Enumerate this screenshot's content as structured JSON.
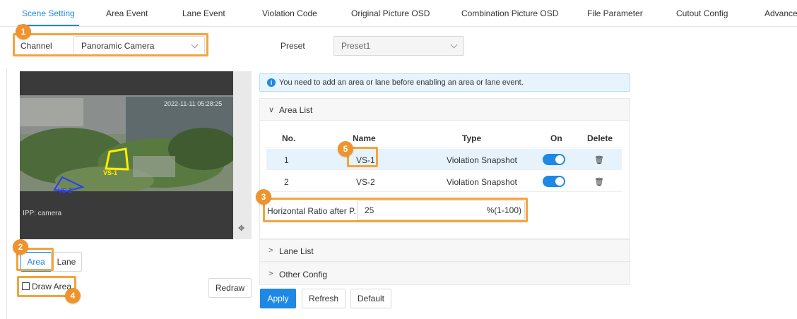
{
  "tabs": [
    {
      "label": "Scene Setting",
      "active": true
    },
    {
      "label": "Area Event"
    },
    {
      "label": "Lane Event"
    },
    {
      "label": "Violation Code"
    },
    {
      "label": "Original Picture OSD"
    },
    {
      "label": "Combination Picture OSD"
    },
    {
      "label": "File Parameter"
    },
    {
      "label": "Cutout Config"
    },
    {
      "label": "Advanced"
    }
  ],
  "channel": {
    "label": "Channel",
    "value": "Panoramic Camera"
  },
  "preset": {
    "label": "Preset",
    "value": "Preset1"
  },
  "video": {
    "timestamp": "2022-11-11 05:28:25",
    "overlay_label": "IPP: camera",
    "area_labels": [
      "VS-1",
      "VS-2"
    ]
  },
  "mode_buttons": {
    "area": "Area",
    "lane": "Lane"
  },
  "draw_area_label": "Draw Area",
  "redraw_label": "Redraw",
  "notice": "You need to add an area or lane before enabling an area or lane event.",
  "area_list": {
    "title": "Area List",
    "headers": {
      "no": "No.",
      "name": "Name",
      "type": "Type",
      "on": "On",
      "delete": "Delete"
    },
    "rows": [
      {
        "no": "1",
        "name": "VS-1",
        "type": "Violation Snapshot",
        "on": true
      },
      {
        "no": "2",
        "name": "VS-2",
        "type": "Violation Snapshot",
        "on": true
      }
    ]
  },
  "horizontal_ratio": {
    "label": "Horizontal Ratio after P...",
    "value": "25",
    "unit": "%(1-100)"
  },
  "lane_list_title": "Lane List",
  "other_config_title": "Other Config",
  "actions": {
    "apply": "Apply",
    "refresh": "Refresh",
    "default": "Default"
  },
  "callouts": [
    "1",
    "2",
    "3",
    "4",
    "5"
  ],
  "colors": {
    "accent": "#1e88e5",
    "highlight": "#f5a33c",
    "callout": "#f0932b"
  }
}
